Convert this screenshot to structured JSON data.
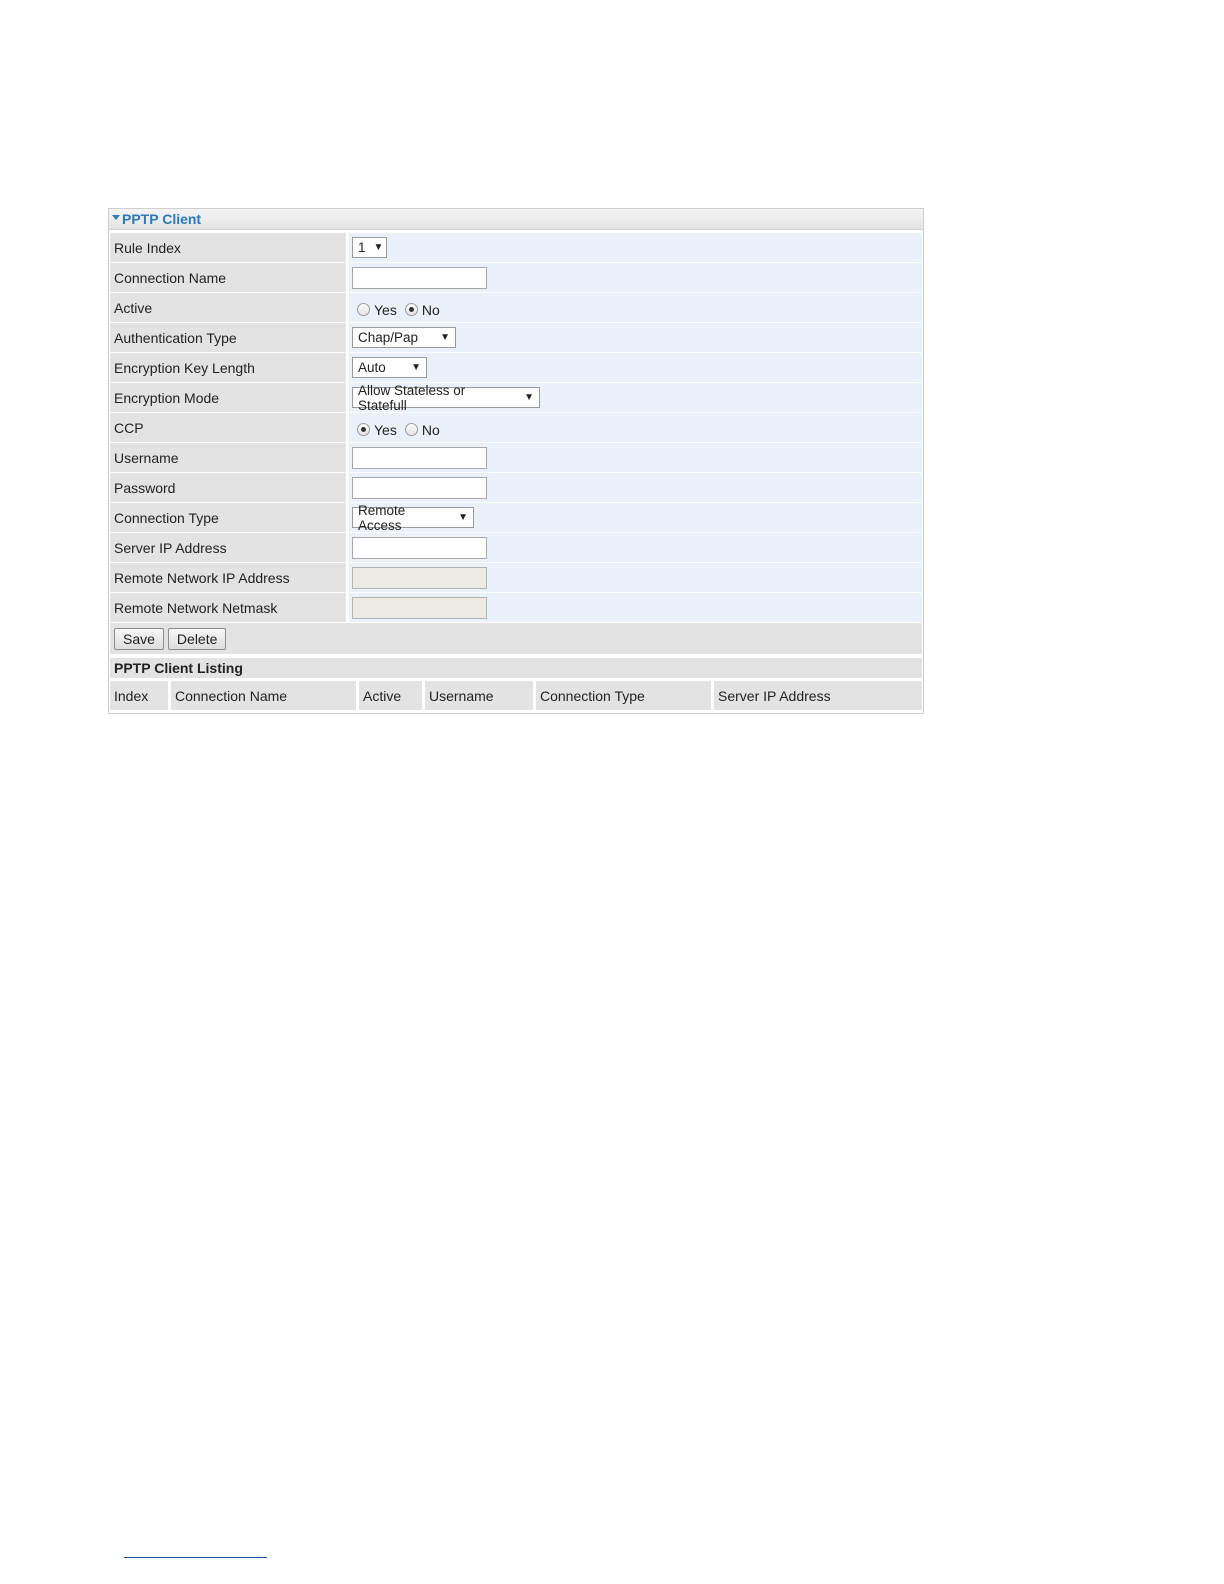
{
  "panel": {
    "title": "PPTP Client"
  },
  "form": {
    "rule_index": {
      "label": "Rule Index",
      "value": "1"
    },
    "connection_name": {
      "label": "Connection Name",
      "value": ""
    },
    "active": {
      "label": "Active",
      "options": [
        "Yes",
        "No"
      ],
      "selected": "No"
    },
    "authentication_type": {
      "label": "Authentication Type",
      "value": "Chap/Pap"
    },
    "encryption_key_length": {
      "label": "Encryption Key Length",
      "value": "Auto"
    },
    "encryption_mode": {
      "label": "Encryption Mode",
      "value": "Allow Stateless or Statefull"
    },
    "ccp": {
      "label": "CCP",
      "options": [
        "Yes",
        "No"
      ],
      "selected": "Yes"
    },
    "username": {
      "label": "Username",
      "value": ""
    },
    "password": {
      "label": "Password",
      "value": ""
    },
    "connection_type": {
      "label": "Connection Type",
      "value": "Remote Access"
    },
    "server_ip": {
      "label": "Server IP Address",
      "value": ""
    },
    "remote_network_ip": {
      "label": "Remote Network IP Address",
      "value": ""
    },
    "remote_network_netmask": {
      "label": "Remote Network Netmask",
      "value": ""
    }
  },
  "buttons": {
    "save": "Save",
    "delete": "Delete"
  },
  "listing": {
    "title": "PPTP Client Listing",
    "columns": [
      "Index",
      "Connection Name",
      "Active",
      "Username",
      "Connection Type",
      "Server IP Address"
    ]
  },
  "colors": {
    "header_text": "#2a7ab8",
    "label_bg": "#e3e3e3",
    "value_bg": "#eaf1fa"
  }
}
